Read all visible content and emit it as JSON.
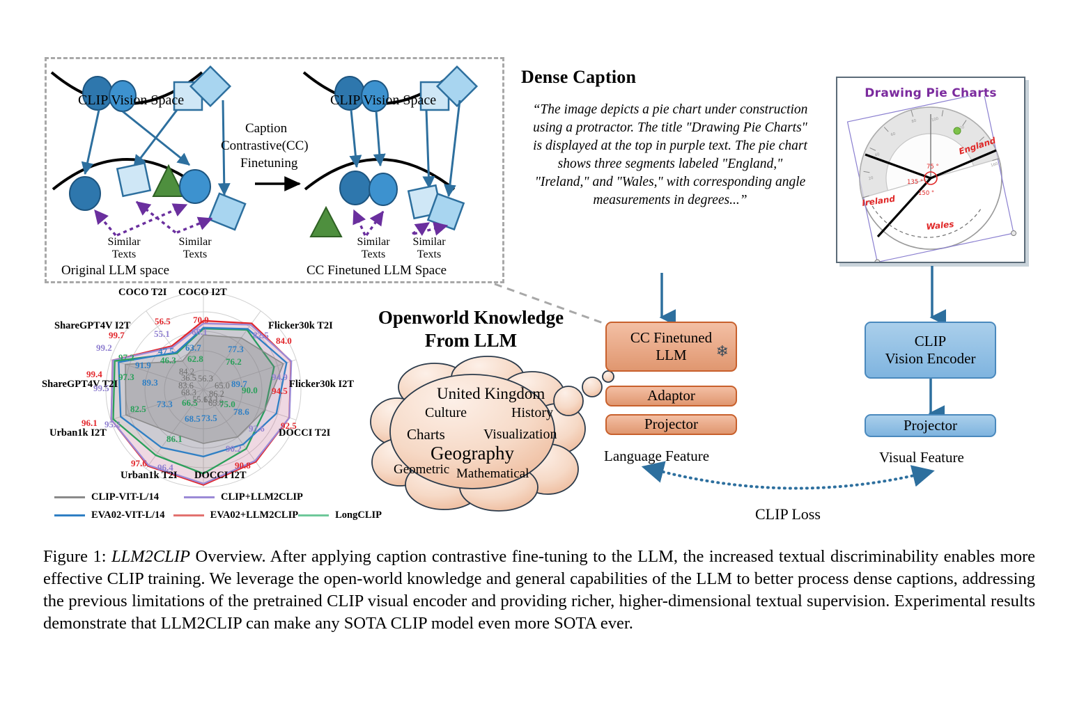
{
  "figure": {
    "caption_prefix": "Figure 1: ",
    "caption_italic": "LLM2CLIP",
    "caption_rest": " Overview. After applying caption contrastive fine-tuning to the LLM, the increased textual discriminability enables more effective CLIP training. We leverage the open-world knowledge and general capabilities of the LLM to better process dense captions, addressing the previous limitations of the pretrained CLIP visual encoder and providing richer, higher-dimensional textual supervision. Experimental results demonstrate that LLM2CLIP can make any SOTA CLIP model even more SOTA ever."
  },
  "topleft": {
    "left_space_title": "CLIP Vision Space",
    "right_space_title": "CLIP Vision Space",
    "arrow_caption_line1": "Caption",
    "arrow_caption_line2": "Contrastive(CC)",
    "arrow_caption_line3": "Finetuning",
    "left_similar_1": "Similar\nTexts",
    "left_similar_2": "Similar\nTexts",
    "right_similar_1": "Similar\nTexts",
    "right_similar_2": "Similar\nTexts",
    "left_bottom_label": "Original LLM space",
    "right_bottom_label": "CC Finetuned LLM Space"
  },
  "dense_caption": {
    "title": "Dense Caption",
    "text": "“The image depicts a pie chart under construction using a protractor. The title \"Drawing Pie Charts\" is displayed at the top in purple text. The pie chart shows three segments labeled \"England,\" \"Ireland,\" and \"Wales,\" with corresponding angle measurements in degrees...”"
  },
  "pie_image": {
    "title": "Drawing Pie Charts",
    "title_color": "#7b2b9e",
    "labels": [
      "England",
      "Ireland",
      "Wales"
    ],
    "angles": [
      "75 °",
      "135 °",
      "150 °"
    ]
  },
  "openworld": {
    "title_line1": "Openworld Knowledge",
    "title_line2": "From LLM",
    "cloud_words": [
      "United Kingdom",
      "Culture",
      "History",
      "Charts",
      "Visualization",
      "Geography",
      "Geometric",
      "Mathematical"
    ]
  },
  "pipeline": {
    "language": {
      "box1_line1": "CC Finetuned",
      "box1_line2": "LLM",
      "box1_icon": "snowflake-icon",
      "box2": "Adaptor",
      "box3": "Projector",
      "feature_label": "Language Feature",
      "color": "#e09770"
    },
    "vision": {
      "box1_line1": "CLIP",
      "box1_line2": "Vision Encoder",
      "box2": "Projector",
      "feature_label": "Visual Feature",
      "color": "#7fb4df"
    },
    "loss_label": "CLIP Loss"
  },
  "chart_data": {
    "type": "radar",
    "title": "",
    "axes": [
      "COCO I2T",
      "Flicker30k T2I",
      "Flicker30k I2T",
      "DOCCI T2I",
      "DOCCI I2T",
      "Urban1k T2I",
      "Urban1k I2T",
      "ShareGPT4V T2I",
      "ShareGPT4V I2T",
      "COCO T2I"
    ],
    "series": [
      {
        "name": "CLIP-VIT-L/14",
        "color": "#8a8a8a",
        "values": [
          56.3,
          65.0,
          86.2,
          65.8,
          63.1,
          55.1,
          68.3,
          83.6,
          84.2,
          36.5
        ]
      },
      {
        "name": "CLIP+LLM2CLIP",
        "color": "#9b8ad6",
        "values": [
          68.1,
          82.5,
          94.9,
          92.6,
          90.2,
          96.4,
          95.2,
          99.5,
          99.2,
          55.1
        ]
      },
      {
        "name": "EVA02-VIT-L/14",
        "color": "#2f7fc4",
        "values": [
          63.7,
          77.3,
          89.7,
          78.6,
          73.5,
          68.5,
          73.3,
          89.3,
          91.9,
          47.5
        ]
      },
      {
        "name": "EVA02+LLM2CLIP",
        "color": "#e2272c",
        "values": [
          70.9,
          84.0,
          94.5,
          92.5,
          90.8,
          97.6,
          96.1,
          99.4,
          99.7,
          56.5
        ]
      },
      {
        "name": "LongCLIP",
        "color": "#2aa05a",
        "values": [
          62.8,
          76.2,
          90.0,
          66.5,
          75.0,
          86.1,
          82.5,
          97.3,
          97.2,
          46.3
        ]
      }
    ],
    "legend_position": "bottom-left",
    "grid": true,
    "ylim": [
      0,
      100
    ],
    "value_labels": {
      "COCO_T2I": {
        "gray": "36.5",
        "blue": "47.5",
        "green": "46.3",
        "purple": "55.1",
        "red": "56.5"
      },
      "COCO_I2T": {
        "gray": "56.3",
        "blue": "63.7",
        "green": "62.8",
        "purple": "68.1",
        "red": "70.9"
      },
      "Flicker30k_T2I": {
        "gray": "65.0",
        "blue": "77.3",
        "green": "76.2",
        "purple": "82.5",
        "red": "84.0"
      },
      "Flicker30k_I2T": {
        "gray": "86.2",
        "blue": "89.7",
        "green": "90.0",
        "purple": "94.9",
        "red": "94.5"
      },
      "DOCCI_T2I": {
        "gray": "65.8",
        "blue": "78.6",
        "green": "66.5",
        "purple": "92.6",
        "red": "92.5"
      },
      "DOCCI_I2T": {
        "gray": "63.1",
        "blue": "73.5",
        "green": "75.0",
        "purple": "90.2",
        "red": "90.8"
      },
      "Urban1k_T2I": {
        "gray": "55.1",
        "blue": "68.5",
        "green": "86.1",
        "purple": "96.4",
        "red": "97.6"
      },
      "Urban1k_I2T": {
        "gray": "68.3",
        "blue": "73.3",
        "green": "82.5",
        "purple": "95.2",
        "red": "96.1"
      },
      "ShareGPT4V_T2I": {
        "gray": "83.6",
        "blue": "89.3",
        "green": "97.3",
        "purple": "99.5",
        "red": "99.4"
      },
      "ShareGPT4V_I2T": {
        "gray": "84.2",
        "blue": "91.9",
        "green": "97.2",
        "purple": "99.2",
        "red": "99.7"
      }
    }
  }
}
